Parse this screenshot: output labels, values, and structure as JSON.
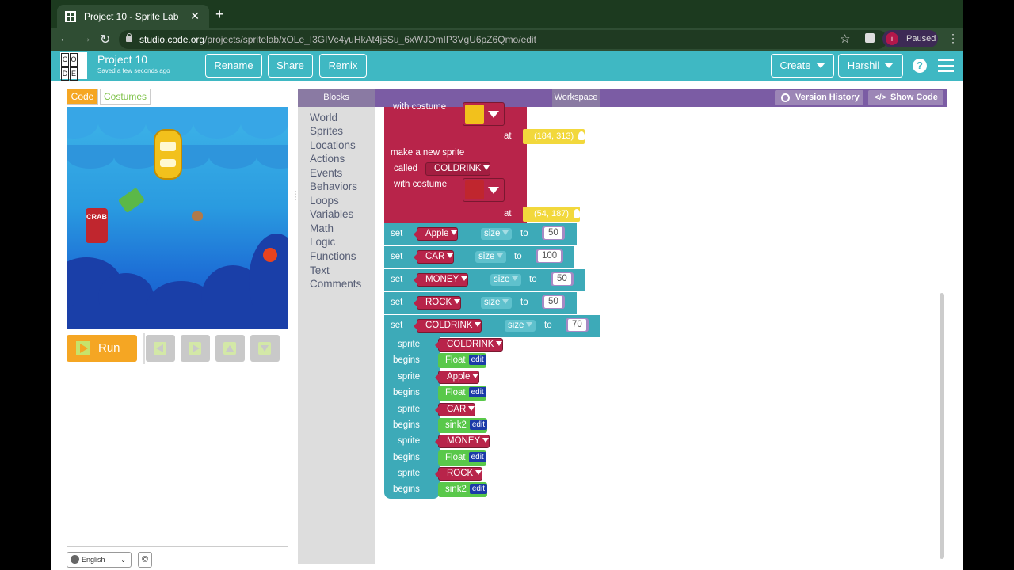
{
  "browser": {
    "tab_title": "Project 10 - Sprite Lab",
    "tab_close": "✕",
    "new_tab": "+",
    "url_host": "studio.code.org",
    "url_path": "/projects/spritelab/xOLe_I3GIVc4yuHkAt4j5Su_6xWJOmIP3VgU6pZ6Qmo/edit",
    "profile_initial": "i",
    "paused_label": "Paused"
  },
  "header": {
    "logo_letters": [
      "C",
      "O",
      "D",
      "",
      "D",
      "E"
    ],
    "project_name": "Project 10",
    "saved_status": "Saved a few seconds ago",
    "rename_label": "Rename",
    "share_label": "Share",
    "remix_label": "Remix",
    "create_label": "Create",
    "user_label": "Harshil",
    "help_label": "?"
  },
  "left": {
    "tab_code": "Code",
    "tab_costumes": "Costumes",
    "can_text": "CRAB",
    "run_label": "Run",
    "language": "English",
    "copyright": "©"
  },
  "editor": {
    "blocks_header": "Blocks",
    "workspace_header": "Workspace",
    "version_history": "Version History",
    "show_code": "Show Code",
    "categories": [
      "World",
      "Sprites",
      "Locations",
      "Actions",
      "Events",
      "Behaviors",
      "Loops",
      "Variables",
      "Math",
      "Logic",
      "Functions",
      "Text",
      "Comments"
    ]
  },
  "blocks": {
    "first_with_costume": "with costume",
    "first_at": "at",
    "first_loc": "(184, 313)",
    "make_sprite": "make a new sprite",
    "called": "called",
    "called_value": "COLDRINK",
    "with_costume": "with costume",
    "at": "at",
    "loc": "(54, 187)",
    "set_rows": [
      {
        "set": "set",
        "sprite": "Apple",
        "prop": "size",
        "to": "to",
        "value": "50"
      },
      {
        "set": "set",
        "sprite": "CAR",
        "prop": "size",
        "to": "to",
        "value": "100"
      },
      {
        "set": "set",
        "sprite": "MONEY",
        "prop": "size",
        "to": "to",
        "value": "50"
      },
      {
        "set": "set",
        "sprite": "ROCK",
        "prop": "size",
        "to": "to",
        "value": "50"
      },
      {
        "set": "set",
        "sprite": "COLDRINK",
        "prop": "size",
        "to": "to",
        "value": "70"
      }
    ],
    "begins_rows": [
      {
        "sprite_label": "sprite",
        "sprite": "COLDRINK",
        "begins": "begins",
        "behavior": "Float",
        "edit": "edit"
      },
      {
        "sprite_label": "sprite",
        "sprite": "Apple",
        "begins": "begins",
        "behavior": "Float",
        "edit": "edit"
      },
      {
        "sprite_label": "sprite",
        "sprite": "CAR",
        "begins": "begins",
        "behavior": "sink2",
        "edit": "edit"
      },
      {
        "sprite_label": "sprite",
        "sprite": "MONEY",
        "begins": "begins",
        "behavior": "Float",
        "edit": "edit"
      },
      {
        "sprite_label": "sprite",
        "sprite": "ROCK",
        "begins": "begins",
        "behavior": "sink2",
        "edit": "edit"
      }
    ]
  },
  "colors": {
    "chrome_bg": "#1c3a1f",
    "header_teal": "#3fb8c3",
    "editor_purple": "#7b5ca4",
    "sprite_red": "#b8244a",
    "set_teal": "#3daab8",
    "behavior_green": "#59c84a",
    "location_yellow": "#f2d83c",
    "run_orange": "#f5a623"
  }
}
